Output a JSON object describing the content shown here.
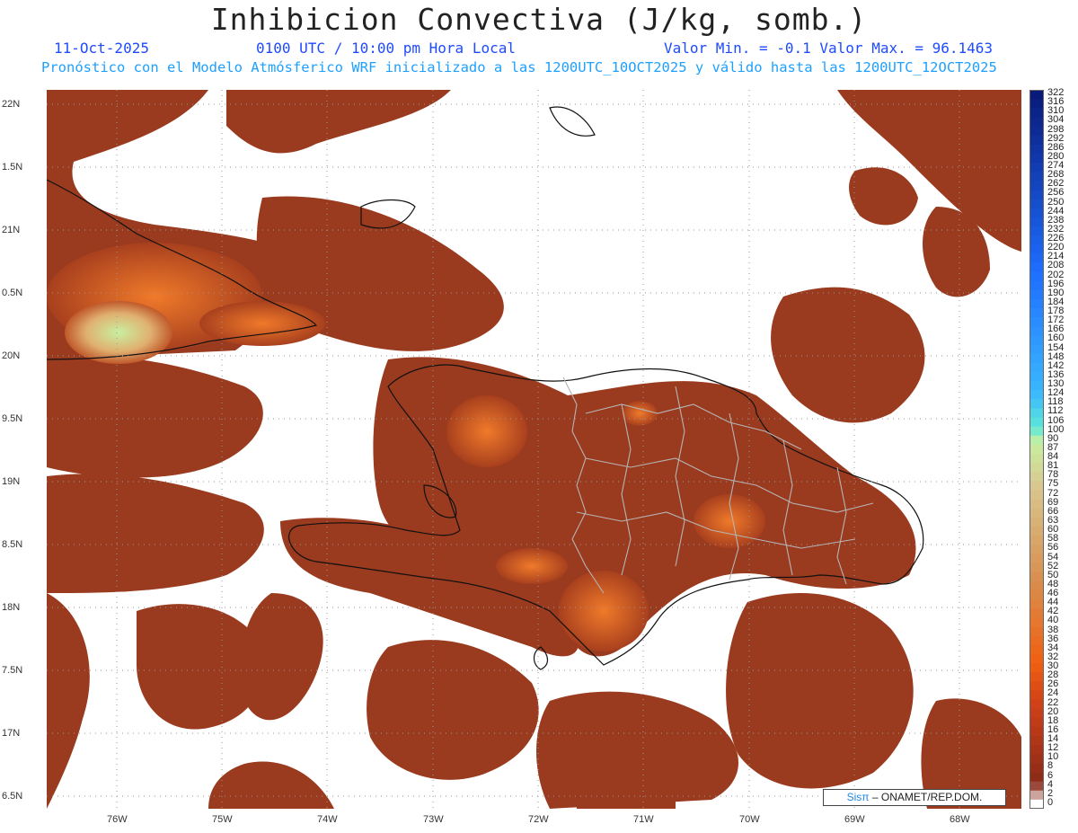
{
  "header": {
    "title": "Inhibicion Convectiva (J/kg, somb.)",
    "date": "11-Oct-2025",
    "time": "0100 UTC / 10:00 pm Hora Local",
    "minmax": "Valor Min. = -0.1  Valor Max. = 96.1463",
    "forecast": "Pronóstico con el Modelo Atmósferico WRF inicializado a las 1200UTC_10OCT2025 y válido hasta las  1200UTC_12OCT2025"
  },
  "axes": {
    "lat_labels": [
      "22N",
      "1.5N",
      "21N",
      "0.5N",
      "20N",
      "9.5N",
      "19N",
      "8.5N",
      "18N",
      "7.5N",
      "17N",
      "6.5N"
    ],
    "lon_labels": [
      "76W",
      "75W",
      "74W",
      "73W",
      "72W",
      "71W",
      "70W",
      "69W",
      "68W"
    ]
  },
  "legend": {
    "labels": [
      "322",
      "316",
      "310",
      "304",
      "298",
      "292",
      "286",
      "280",
      "274",
      "268",
      "262",
      "256",
      "250",
      "244",
      "238",
      "232",
      "226",
      "220",
      "214",
      "208",
      "202",
      "196",
      "190",
      "184",
      "178",
      "172",
      "166",
      "160",
      "154",
      "148",
      "142",
      "136",
      "130",
      "124",
      "118",
      "112",
      "106",
      "100",
      "90",
      "87",
      "84",
      "81",
      "78",
      "75",
      "72",
      "69",
      "66",
      "63",
      "60",
      "58",
      "56",
      "54",
      "52",
      "50",
      "48",
      "46",
      "44",
      "42",
      "40",
      "38",
      "36",
      "34",
      "32",
      "30",
      "28",
      "26",
      "24",
      "22",
      "20",
      "18",
      "16",
      "14",
      "12",
      "10",
      "8",
      "6",
      "4",
      "2",
      "0"
    ],
    "colors": {
      "high": "#0a1a7a",
      "mid_blue": "#1e90ff",
      "cyan": "#5ee8d8",
      "pale_green": "#c8f0a0",
      "tan": "#c8a060",
      "orange": "#f06010",
      "dark_red": "#8a2a18",
      "field": "#9a3a1e"
    }
  },
  "credit": {
    "brand": "Sisπ",
    "text": " – ONAMET/REP.DOM."
  }
}
